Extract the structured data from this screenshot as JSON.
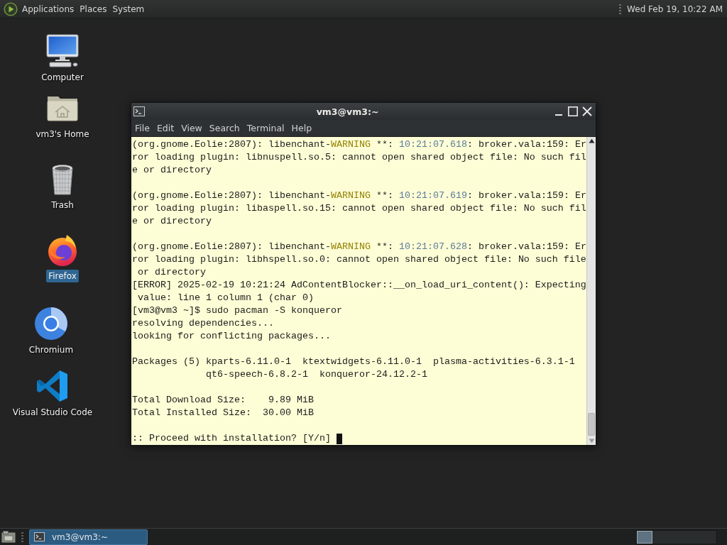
{
  "top_panel": {
    "menus": [
      "Applications",
      "Places",
      "System"
    ],
    "clock": "Wed Feb 19, 10:22 AM"
  },
  "desktop_icons": [
    {
      "label": "Computer",
      "kind": "computer",
      "selected": false
    },
    {
      "label": "vm3's Home",
      "kind": "home",
      "selected": false
    },
    {
      "label": "Trash",
      "kind": "trash",
      "selected": false
    },
    {
      "label": "Firefox",
      "kind": "firefox",
      "selected": true
    },
    {
      "label": "Chromium",
      "kind": "chromium",
      "selected": false
    },
    {
      "label": "Visual Studio Code",
      "kind": "vscode",
      "selected": false
    }
  ],
  "terminal_window": {
    "title": "vm3@vm3:~",
    "menu": [
      "File",
      "Edit",
      "View",
      "Search",
      "Terminal",
      "Help"
    ],
    "blocks": [
      [
        {
          "segments": [
            {
              "kind": "plain",
              "text": "(org.gnome.Eolie:2807): libenchant-"
            },
            {
              "kind": "warning",
              "text": "WARNING"
            },
            {
              "kind": "plain",
              "text": " **: "
            },
            {
              "kind": "timestamp",
              "text": "10:21:07.618"
            },
            {
              "kind": "plain",
              "text": ": broker.vala:159: Er"
            }
          ]
        },
        "ror loading plugin: libnuspell.so.5: cannot open shared object file: No such fil",
        "e or directory"
      ],
      [
        {
          "segments": [
            {
              "kind": "plain",
              "text": "(org.gnome.Eolie:2807): libenchant-"
            },
            {
              "kind": "warning",
              "text": "WARNING"
            },
            {
              "kind": "plain",
              "text": " **: "
            },
            {
              "kind": "timestamp",
              "text": "10:21:07.619"
            },
            {
              "kind": "plain",
              "text": ": broker.vala:159: Er"
            }
          ]
        },
        "ror loading plugin: libaspell.so.15: cannot open shared object file: No such fil",
        "e or directory"
      ],
      [
        {
          "segments": [
            {
              "kind": "plain",
              "text": "(org.gnome.Eolie:2807): libenchant-"
            },
            {
              "kind": "warning",
              "text": "WARNING"
            },
            {
              "kind": "plain",
              "text": " **: "
            },
            {
              "kind": "timestamp",
              "text": "10:21:07.628"
            },
            {
              "kind": "plain",
              "text": ": broker.vala:159: Er"
            }
          ]
        },
        "ror loading plugin: libhspell.so.0: cannot open shared object file: No such file",
        " or directory",
        "[ERROR] 2025-02-19 10:21:24 AdContentBlocker::__on_load_uri_content(): Expecting",
        " value: line 1 column 1 (char 0)",
        "[vm3@vm3 ~]$ sudo pacman -S konqueror",
        "resolving dependencies...",
        "looking for conflicting packages..."
      ],
      [
        "Packages (5) kparts-6.11.0-1  ktextwidgets-6.11.0-1  plasma-activities-6.3.1-1",
        "             qt6-speech-6.8.2-1  konqueror-24.12.2-1"
      ],
      [
        "Total Download Size:    9.89 MiB",
        "Total Installed Size:  30.00 MiB"
      ],
      [
        ":: Proceed with installation? [Y/n] "
      ]
    ],
    "cursor_visible": true
  },
  "bottom_panel": {
    "tasks": [
      {
        "title": "vm3@vm3:~",
        "selected": true
      }
    ],
    "workspaces": [
      {
        "selected": true
      }
    ]
  }
}
